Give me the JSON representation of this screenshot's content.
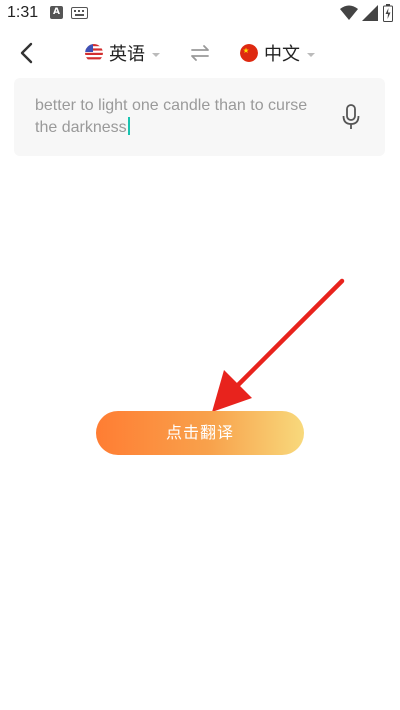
{
  "status_bar": {
    "time": "1:31",
    "icons": [
      "text-a-icon",
      "keyboard-icon",
      "wifi-icon",
      "signal-icon",
      "battery-icon"
    ]
  },
  "header": {
    "back_icon": "chevron-left-icon",
    "source_language": {
      "label": "英语",
      "flag": "us-flag-icon"
    },
    "swap_icon": "swap-arrows-icon",
    "target_language": {
      "label": "中文",
      "flag": "china-flag-icon"
    }
  },
  "input": {
    "value": "better to light one candle than to curse the darkness",
    "mic_icon": "microphone-icon"
  },
  "annotation": {
    "arrow_color": "#e8231d"
  },
  "translate_button": {
    "label": "点击翻译"
  },
  "colors": {
    "accent_start": "#ff7d33",
    "accent_end": "#f8d97c",
    "cursor": "#19c3b0"
  }
}
